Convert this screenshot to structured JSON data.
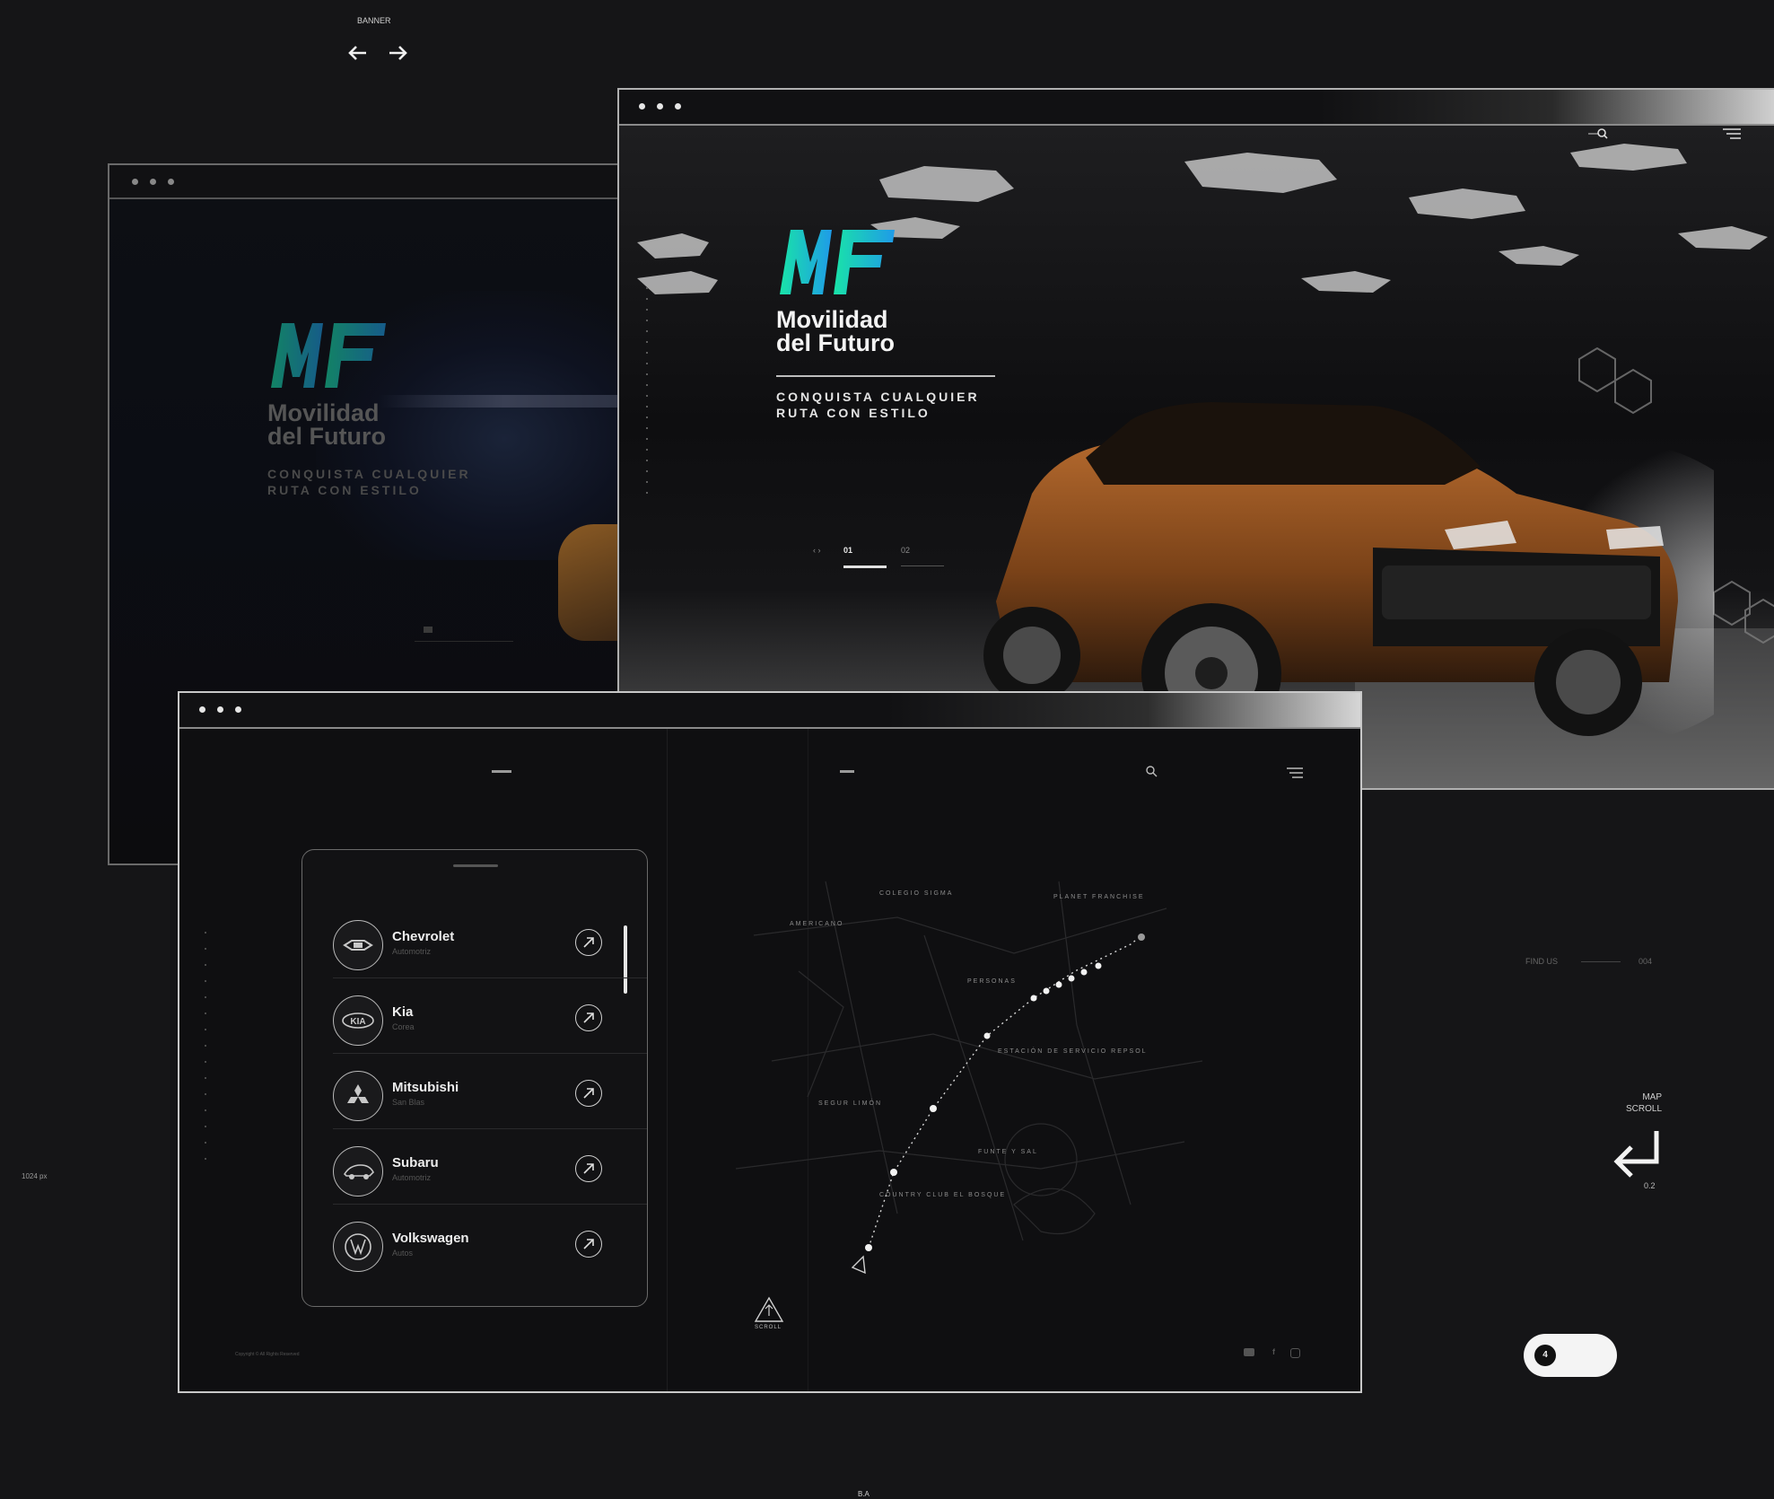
{
  "page": {
    "section_label": "BANNER",
    "width_note": "1024 px",
    "footer_mark": "B.A"
  },
  "nav_arrows": {
    "left_icon": "arrow-left-icon",
    "right_icon": "arrow-right-icon"
  },
  "brand": {
    "logo_letters": "MF",
    "name_line1": "Movilidad",
    "name_line2": "del Futuro",
    "tagline_line1": "CONQUISTA CUALQUIER",
    "tagline_line2": "RUTA CON ESTILO"
  },
  "hero": {
    "slide_current": "01",
    "slide_next": "02",
    "slide_prev_glyph": "‹ ›"
  },
  "map_window": {
    "brands": [
      {
        "name": "Chevrolet",
        "sub": "Automotriz",
        "icon": "chevrolet-logo-icon"
      },
      {
        "name": "Kia",
        "sub": "Corea",
        "icon": "kia-logo-icon"
      },
      {
        "name": "Mitsubishi",
        "sub": "San Blas",
        "icon": "mitsubishi-logo-icon"
      },
      {
        "name": "Subaru",
        "sub": "Automotriz",
        "icon": "subaru-logo-icon"
      },
      {
        "name": "Volkswagen",
        "sub": "Autos",
        "icon": "volkswagen-logo-icon"
      }
    ],
    "map_labels": [
      "ESTACIÓN DE SERVICIO REPSOL",
      "SEGUR LIMÓN",
      "COUNTRY CLUB EL BOSQUE",
      "FUNTE Y SAL",
      "PERSONAS",
      "COLEGIO SIGMA",
      "PLANET FRANCHISE",
      "AMERICANO"
    ],
    "scroll_label": "SCROLL",
    "copyright": "Copyright © All Rights Reserved"
  },
  "side": {
    "find_us": "FIND US",
    "find_us_value": "004",
    "map_scroll_line1": "MAP",
    "map_scroll_line2": "SCROLL",
    "map_scroll_value": "0.2",
    "toggle_value": "4"
  },
  "colors": {
    "background": "#151517",
    "logo_gradient_start": "#19e3a8",
    "logo_gradient_end": "#1f9be8",
    "car": "#8a4a1f"
  }
}
